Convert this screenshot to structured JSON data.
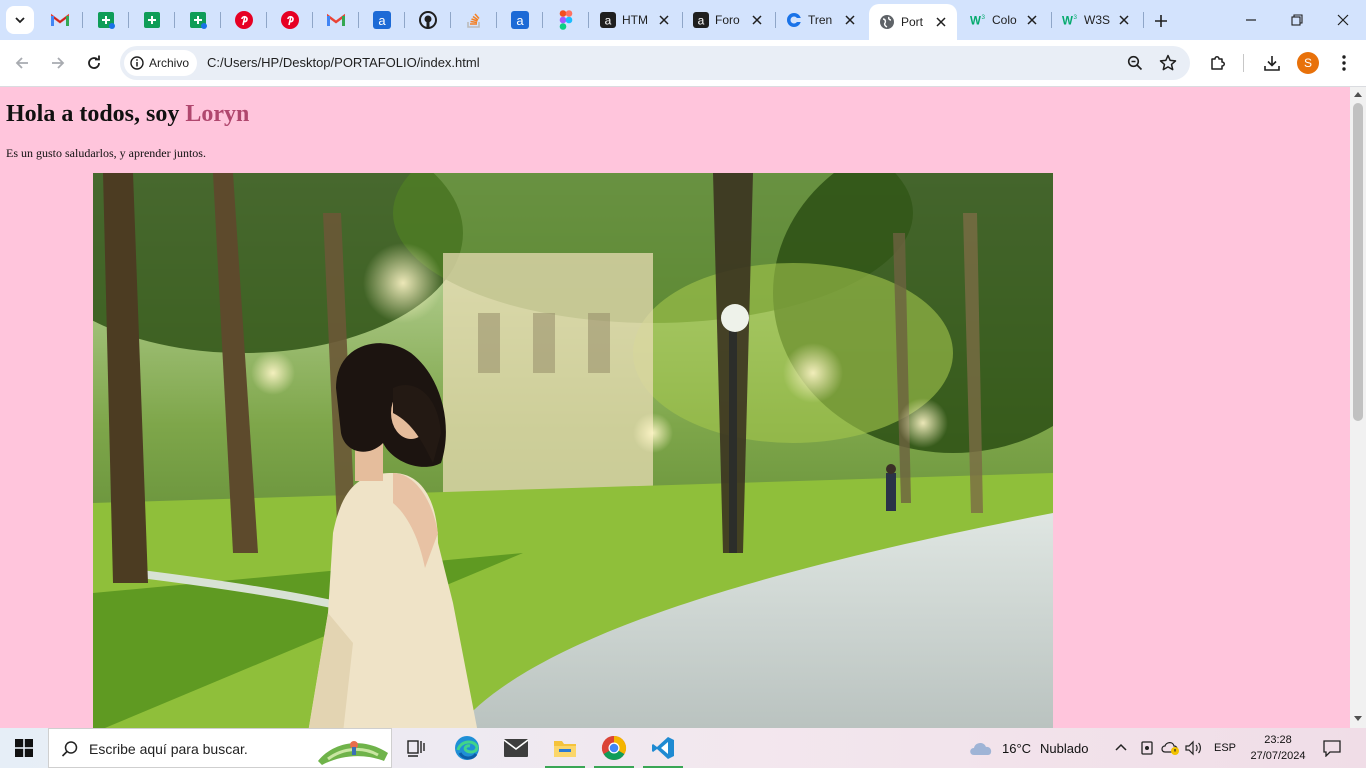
{
  "browser": {
    "tabs": [
      {
        "title": "HTML",
        "favicon": "alura-icon"
      },
      {
        "title": "Foro",
        "favicon": "alura-icon"
      },
      {
        "title": "Tren",
        "favicon": "chrome-c-icon"
      },
      {
        "title": "Port",
        "favicon": "globe-icon",
        "active": true
      },
      {
        "title": "Colo",
        "favicon": "w3schools-icon"
      },
      {
        "title": "W3S",
        "favicon": "w3schools-icon"
      }
    ],
    "pinned_tabs": [
      "gmail-icon",
      "sheets-icon",
      "sheets-icon",
      "sheets-icon",
      "pinterest-icon",
      "pinterest-icon",
      "gmail-icon",
      "alura-icon",
      "github-icon",
      "stackoverflow-icon",
      "alura-icon",
      "figma-icon"
    ],
    "address": {
      "chip_label": "Archivo",
      "url": "C:/Users/HP/Desktop/PORTAFOLIO/index.html"
    },
    "profile_initial": "S"
  },
  "page": {
    "heading_prefix": "Hola a todos, soy ",
    "heading_name": "Loryn",
    "paragraph": "Es un gusto saludarlos, y aprender juntos.",
    "background": "#ffc5dc",
    "name_color": "#b0476e"
  },
  "taskbar": {
    "search_placeholder": "Escribe aquí para buscar.",
    "apps": [
      "task-view-icon",
      "edge-icon",
      "mail-icon",
      "file-explorer-icon",
      "chrome-icon",
      "vscode-icon"
    ],
    "weather_temp": "16°C",
    "weather_desc": "Nublado",
    "language": "ESP",
    "time": "23:28",
    "date": "27/07/2024"
  }
}
